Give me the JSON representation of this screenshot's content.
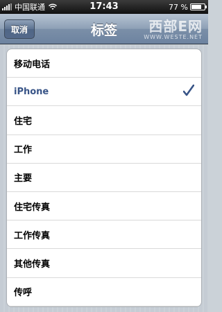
{
  "status": {
    "carrier": "中国联通",
    "time": "17:43",
    "battery": "77 %",
    "battery_level": 0.77
  },
  "nav": {
    "title": "标签",
    "cancel_label": "取消"
  },
  "watermark": {
    "main": "西部E网",
    "sub": "WWW.WESTE.NET"
  },
  "list": {
    "items": [
      {
        "label": "移动电话",
        "selected": false
      },
      {
        "label": "iPhone",
        "selected": true
      },
      {
        "label": "住宅",
        "selected": false
      },
      {
        "label": "工作",
        "selected": false
      },
      {
        "label": "主要",
        "selected": false
      },
      {
        "label": "住宅传真",
        "selected": false
      },
      {
        "label": "工作传真",
        "selected": false
      },
      {
        "label": "其他传真",
        "selected": false
      },
      {
        "label": "传呼",
        "selected": false
      }
    ]
  },
  "colors": {
    "selected_text": "#385487",
    "nav_bar": "#8da0b6"
  },
  "icons": [
    "signal-icon",
    "wifi-icon",
    "battery-icon",
    "checkmark-icon"
  ]
}
